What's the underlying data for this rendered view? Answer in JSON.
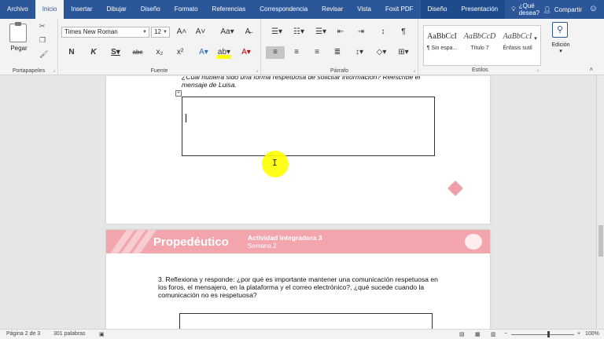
{
  "tabs": [
    "Archivo",
    "Inicio",
    "Insertar",
    "Dibujar",
    "Diseño",
    "Formato",
    "Referencias",
    "Correspondencia",
    "Revisar",
    "Vista",
    "Foxit PDF",
    "Diseño",
    "Presentación"
  ],
  "tell_me": "¿Qué desea?",
  "share": "Compartir",
  "clipboard": {
    "paste": "Pegar",
    "label": "Portapapeles"
  },
  "font": {
    "name": "Times New Roman",
    "size": "12",
    "label": "Fuente"
  },
  "paragraph": {
    "label": "Párrafo"
  },
  "styles": {
    "label": "Estilos",
    "items": [
      {
        "sample": "AaBbCcI",
        "name": "¶ Sin espa..."
      },
      {
        "sample": "AaBbCcD",
        "name": "Título 7"
      },
      {
        "sample": "AaBbCcI",
        "name": "Énfasis sutil"
      }
    ]
  },
  "editing": {
    "label": "Edición"
  },
  "document": {
    "page1_text": "¿Cuál hubiera sido una forma respetuosa de solicitar información? Reescribe el mensaje de Luisa.",
    "banner_title": "Propedéutico",
    "banner_activity": "Actividad integradora 3",
    "banner_week": "Semana 2",
    "question3": "3. Reflexiona y responde: ¿por qué es importante mantener una comunicación respetuosa en los foros, el mensajero, en la plataforma y el correo electrónico?, ¿qué sucede cuando la comunicación no es respetuosa?"
  },
  "status": {
    "page": "Página 2 de 3",
    "words": "301 palabras",
    "zoom": "100%"
  },
  "colors": {
    "accent": "#2b579a",
    "banner": "#f2a5ad",
    "highlight": "#ffff00"
  }
}
